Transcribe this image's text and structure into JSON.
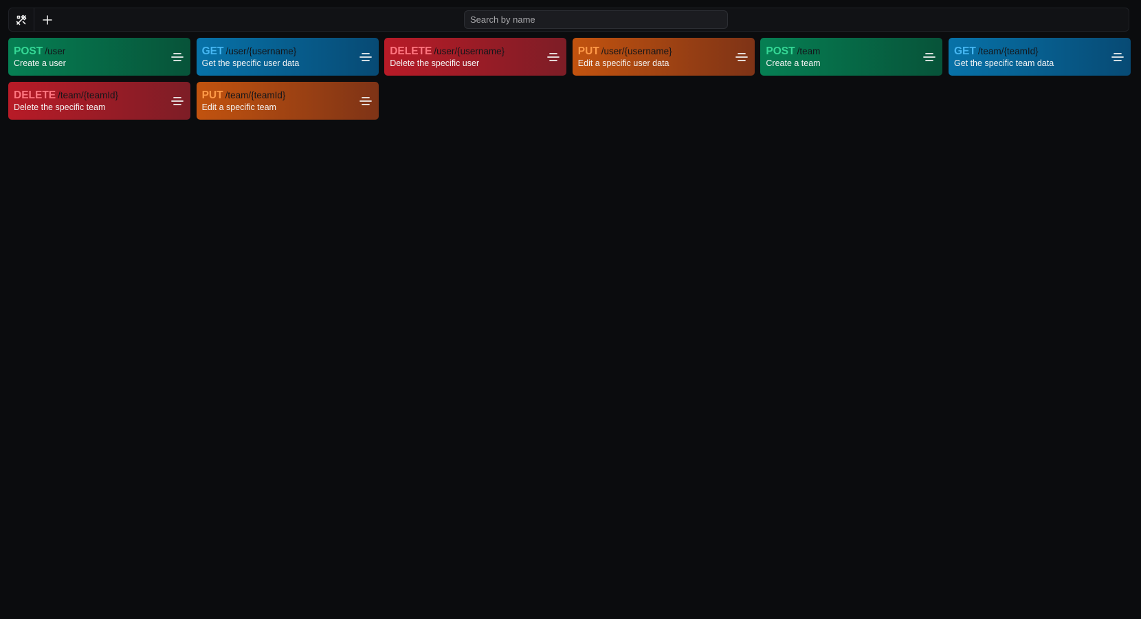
{
  "toolbar": {
    "tools_icon": "tools-icon",
    "add_icon": "plus-icon",
    "search_placeholder": "Search by name",
    "search_value": ""
  },
  "endpoints": [
    {
      "method": "POST",
      "path": "/user",
      "description": "Create a user",
      "kind": "post"
    },
    {
      "method": "GET",
      "path": "/user/{username}",
      "description": "Get the specific user data",
      "kind": "get"
    },
    {
      "method": "DELETE",
      "path": "/user/{username}",
      "description": "Delete the specific user",
      "kind": "delete"
    },
    {
      "method": "PUT",
      "path": "/user/{username}",
      "description": "Edit a specific user data",
      "kind": "put"
    },
    {
      "method": "POST",
      "path": "/team",
      "description": "Create a team",
      "kind": "post"
    },
    {
      "method": "GET",
      "path": "/team/{teamId}",
      "description": "Get the specific team data",
      "kind": "get"
    },
    {
      "method": "DELETE",
      "path": "/team/{teamId}",
      "description": "Delete the specific team",
      "kind": "delete"
    },
    {
      "method": "PUT",
      "path": "/team/{teamId}",
      "description": "Edit a specific team",
      "kind": "put"
    }
  ],
  "colors": {
    "background": "#0b0c0e",
    "post": "#067f53",
    "get": "#0772a8",
    "delete": "#b81b27",
    "put": "#c2530f"
  }
}
